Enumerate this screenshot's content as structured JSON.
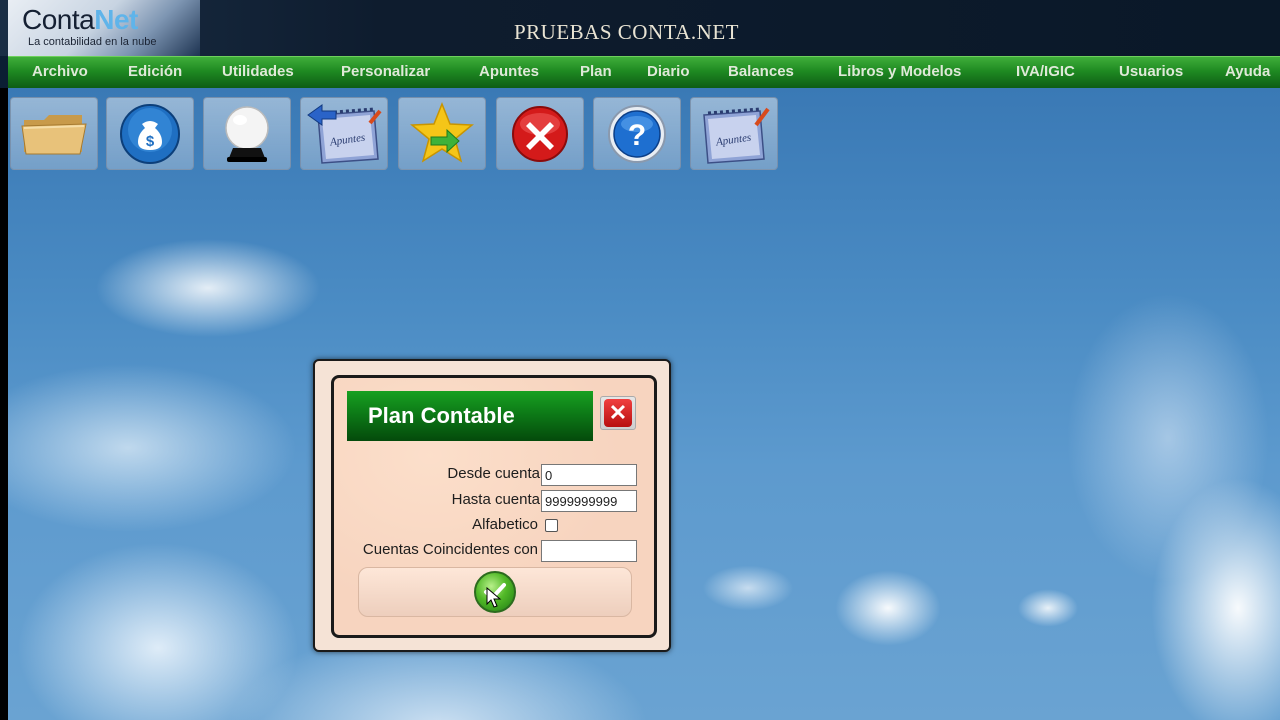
{
  "header": {
    "logo_main": "Conta",
    "logo_accent": "Net",
    "logo_tagline": "La contabilidad en la nube",
    "site_title": "PRUEBAS CONTA.NET"
  },
  "menu": {
    "items": [
      {
        "label": "Archivo"
      },
      {
        "label": "Edición"
      },
      {
        "label": "Utilidades"
      },
      {
        "label": "Personalizar"
      },
      {
        "label": "Apuntes"
      },
      {
        "label": "Plan"
      },
      {
        "label": "Diario"
      },
      {
        "label": "Balances"
      },
      {
        "label": "Libros y Modelos"
      },
      {
        "label": "IVA/IGIC"
      },
      {
        "label": "Usuarios"
      },
      {
        "label": "Ayuda"
      }
    ]
  },
  "toolbar": {
    "buttons": [
      {
        "icon": "folder-icon"
      },
      {
        "icon": "money-bag-icon"
      },
      {
        "icon": "crystal-ball-icon"
      },
      {
        "icon": "apuntes-back-icon",
        "text": "Apuntes"
      },
      {
        "icon": "star-arrow-icon"
      },
      {
        "icon": "close-red-icon"
      },
      {
        "icon": "help-icon"
      },
      {
        "icon": "apuntes-icon",
        "text": "Apuntes"
      }
    ]
  },
  "dialog": {
    "title": "Plan Contable",
    "close_symbol": "✕",
    "desde_label": "Desde cuenta",
    "desde_value": "0",
    "hasta_label": "Hasta cuenta",
    "hasta_value": "9999999999",
    "alfabetico_label": "Alfabetico",
    "alfabetico_checked": false,
    "coincidentes_label": "Cuentas Coincidentes con",
    "coincidentes_value": ""
  },
  "colors": {
    "menu_green": "#1f8a22",
    "title_green": "#0d7a17",
    "dialog_bg": "#f7d4bf",
    "close_red": "#d01c1c"
  }
}
